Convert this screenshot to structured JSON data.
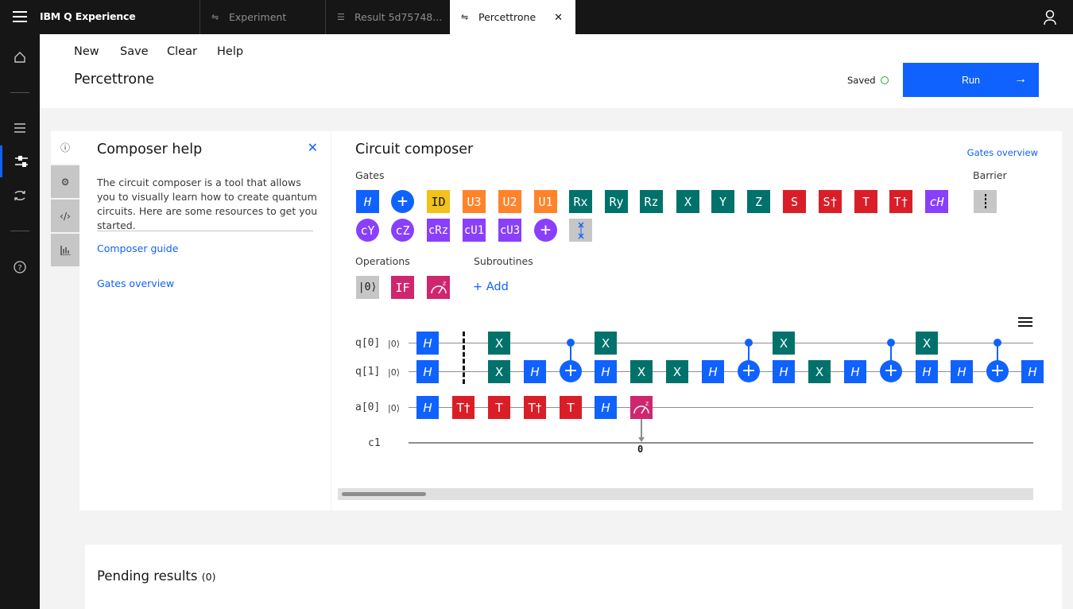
{
  "topbar": {
    "brand": "IBM Q Experience",
    "tabs": [
      {
        "label": "Experiment"
      },
      {
        "label": "Result 5d75748..."
      },
      {
        "label": "Percettrone"
      }
    ]
  },
  "header": {
    "menu": [
      "New",
      "Save",
      "Clear",
      "Help"
    ],
    "title": "Percettrone",
    "saved": "Saved",
    "run": "Run"
  },
  "help": {
    "title": "Composer help",
    "text": "The circuit composer is a tool that allows you to visually learn how to create quantum circuits. Here are some resources to get you started.",
    "links": [
      "Composer guide",
      "Gates overview"
    ]
  },
  "composer": {
    "title": "Circuit composer",
    "gates_overview": "Gates overview",
    "gates_label": "Gates",
    "barrier_label": "Barrier",
    "operations_label": "Operations",
    "subroutines_label": "Subroutines",
    "add_label": "+ Add",
    "gates_row1": [
      "H",
      "+",
      "ID",
      "U3",
      "U2",
      "U1",
      "Rx",
      "Ry",
      "Rz",
      "X",
      "Y",
      "Z",
      "S",
      "S†",
      "T",
      "T†",
      "cH"
    ],
    "gates_row2": [
      "cY",
      "cZ",
      "cRz",
      "cU1",
      "cU3",
      "+",
      "swap"
    ],
    "operations": [
      "|0⟩",
      "IF",
      "measure"
    ],
    "qubits": [
      "q[0]",
      "q[1]",
      "a[0]"
    ],
    "classical": "c1",
    "ket": "|0⟩",
    "measure_bit": "0"
  },
  "pending": {
    "title": "Pending results",
    "count": "(0)"
  }
}
